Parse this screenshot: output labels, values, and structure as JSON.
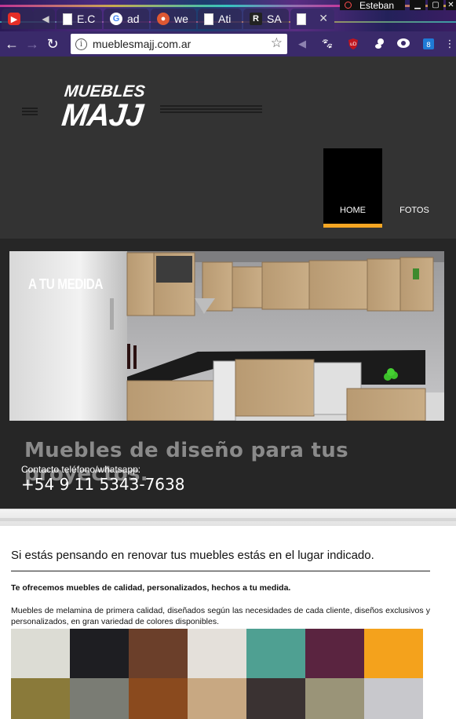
{
  "browser": {
    "tabs": [
      {
        "label": "",
        "icon": "youtube-icon"
      },
      {
        "label": "",
        "icon": "speaker-icon"
      },
      {
        "label": "E.C",
        "icon": "document-icon"
      },
      {
        "label": "ad",
        "icon": "google-icon"
      },
      {
        "label": "we",
        "icon": "duckduckgo-icon"
      },
      {
        "label": "Ati",
        "icon": "document-icon"
      },
      {
        "label": "SA",
        "icon": "r-logo-icon"
      },
      {
        "label": "",
        "icon": "document-icon"
      }
    ],
    "profile_name": "Esteban",
    "url": "mueblesmajj.com.ar"
  },
  "site": {
    "logo_line1": "MUEBLES",
    "logo_line2": "MAJJ",
    "nav": {
      "home": "HOME",
      "fotos": "FOTOS"
    },
    "hero": {
      "image_label": "A TU MEDIDA",
      "title": "Muebles de diseño para tus proyectos.",
      "contact_label": "Contacto teléfono/whatsapp:",
      "phone": "+54 9 11 5343-7638"
    },
    "content": {
      "intro": "Si estás pensando en renovar tus muebles estás en el lugar indicado.",
      "bold_line": "Te ofrecemos muebles de calidad, personalizados, hechos a tu medida.",
      "description": "Muebles de melamina de primera calidad, diseñados según las necesidades de cada cliente, diseños exclusivos y personalizados, en gran variedad de colores disponibles."
    },
    "swatch_colors": [
      "#dcdcd4",
      "#1e1e22",
      "#6b3f2a",
      "#e4e0da",
      "#4fa092",
      "#5a2440",
      "#f4a21c",
      "#8a7a3a",
      "#7a7c74",
      "#8a4a1e",
      "#c8a882",
      "#3a3232",
      "#9a9478",
      "#c8c8cc"
    ],
    "colors": {
      "header_bg": "#333333",
      "accent": "#f5a623",
      "hero_bg": "#262626"
    }
  }
}
